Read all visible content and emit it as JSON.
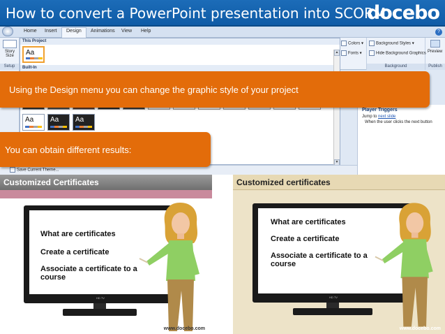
{
  "banner": {
    "title": "How to convert a PowerPoint presentation into SCORM",
    "logo_text": "docebo"
  },
  "ribbon": {
    "tabs": [
      "Home",
      "Insert",
      "Design",
      "Animations",
      "View",
      "Help"
    ],
    "active_tab": "Design",
    "story_size": "Story Size",
    "setup_label": "Setup",
    "colors_label": "Colors",
    "fonts_label": "Fonts",
    "background_styles_label": "Background Styles",
    "hide_background_label": "Hide Background Graphics",
    "background_group_label": "Background",
    "preview_label": "Preview",
    "publish_label": "Publish",
    "this_project_label": "This Project",
    "built_in_label": "Built-In",
    "thumb_text": "Aa",
    "save_theme_label": "Save Current Theme..."
  },
  "player_triggers": {
    "heading": "Player Triggers",
    "line1_prefix": "Jump to ",
    "line1_link": "next slide",
    "line2": "When the user clicks the next button"
  },
  "callouts": {
    "design_menu": "Using the Design menu you can change the graphic style of your project",
    "results": "You can obtain different results:"
  },
  "slides": [
    {
      "title": "Customized Certificates",
      "bullets": [
        "What are certificates",
        "Create a certificate",
        "Associate a certificate to a",
        "course"
      ],
      "tv_label": "HD TV",
      "footer": "www.docebo.com"
    },
    {
      "title": "Customized certificates",
      "bullets": [
        "What are certificates",
        "Create a certificate",
        "Associate a certificate to a",
        "course"
      ],
      "tv_label": "HD TV",
      "footer": "www.docebo.com"
    }
  ],
  "colors": {
    "banner_blue": "#1566b3",
    "callout_orange": "#e36c0a",
    "ribbon_bg": "#dfe8f4"
  },
  "icons": {
    "orb": "office-orb-icon",
    "help": "help-icon",
    "colors": "color-palette-icon",
    "fonts": "font-icon",
    "background": "background-styles-icon",
    "preview": "preview-icon"
  }
}
